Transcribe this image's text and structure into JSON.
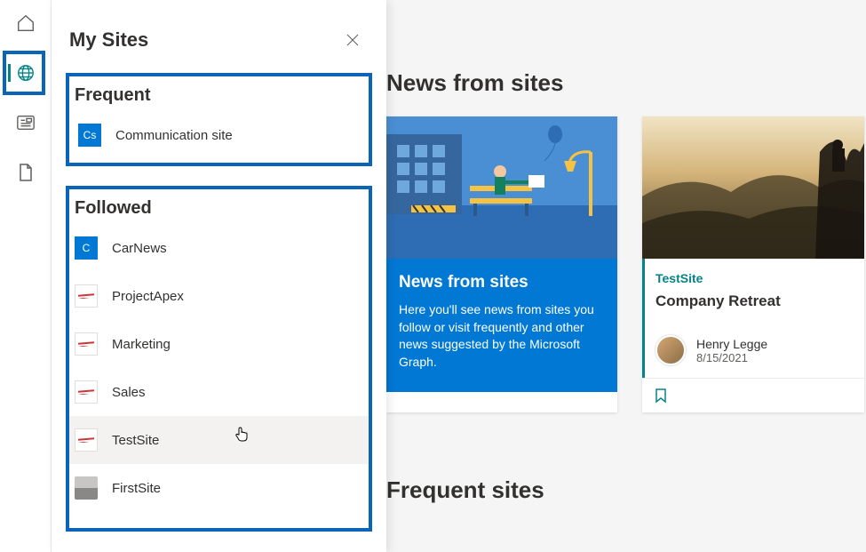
{
  "leftRail": {
    "items": [
      "home",
      "globe",
      "news",
      "file"
    ]
  },
  "flyout": {
    "title": "My Sites",
    "frequent": {
      "heading": "Frequent",
      "items": [
        {
          "iconLetter": "Cs",
          "label": "Communication site",
          "iconType": "blue"
        }
      ]
    },
    "followed": {
      "heading": "Followed",
      "items": [
        {
          "iconLetter": "C",
          "label": "CarNews",
          "iconType": "blue"
        },
        {
          "iconLetter": "",
          "label": "ProjectApex",
          "iconType": "line"
        },
        {
          "iconLetter": "",
          "label": "Marketing",
          "iconType": "line"
        },
        {
          "iconLetter": "",
          "label": "Sales",
          "iconType": "line"
        },
        {
          "iconLetter": "",
          "label": "TestSite",
          "iconType": "line",
          "hovered": true
        },
        {
          "iconLetter": "",
          "label": "FirstSite",
          "iconType": "photo"
        }
      ]
    }
  },
  "main": {
    "newsHeading": "News from sites",
    "card1": {
      "title": "News from sites",
      "desc": "Here you'll see news from sites you follow or visit frequently and other news suggested by the Microsoft Graph."
    },
    "card2": {
      "site": "TestSite",
      "title": "Company Retreat",
      "author": "Henry Legge",
      "date": "8/15/2021"
    },
    "frequentHeading": "Frequent sites"
  }
}
